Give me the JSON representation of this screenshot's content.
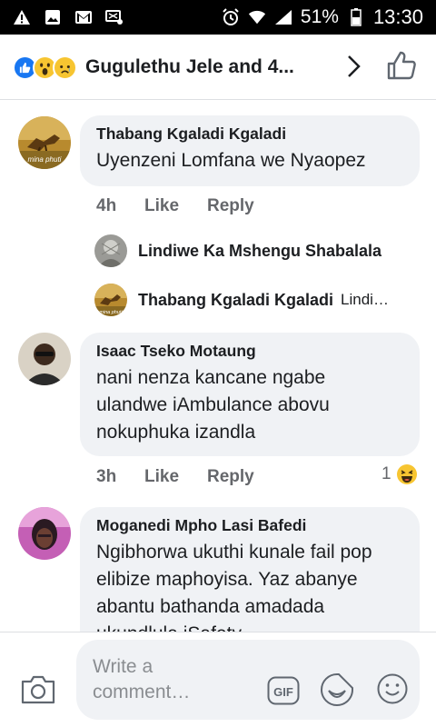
{
  "status_bar": {
    "battery_percent": "51%",
    "time": "13:30"
  },
  "header": {
    "title": "Gugulethu Jele and 4..."
  },
  "comments": [
    {
      "author": "Thabang Kgaladi Kgaladi",
      "text": "Uyenzeni Lomfana we Nyaopez",
      "avatar_caption": "mina phuti",
      "time": "4h",
      "like": "Like",
      "reply": "Reply",
      "replies": [
        {
          "author": "Lindiwe Ka Mshengu Shabalala",
          "preview": ""
        },
        {
          "author": "Thabang Kgaladi Kgaladi",
          "preview": "Lindi…",
          "avatar_caption": "mina phuti"
        }
      ]
    },
    {
      "author": "Isaac Tseko Motaung",
      "text": "nani nenza kancane ngabe ulandwe  iAmbulance abovu nokuphuka izandla",
      "time": "3h",
      "like": "Like",
      "reply": "Reply",
      "reaction_count": "1"
    },
    {
      "author": "Moganedi Mpho Lasi Bafedi",
      "text": "Ngibhorwa ukuthi kunale fail pop elibize maphoyisa. Yaz abanye abantu bathanda amadada ukundlula iSafety"
    }
  ],
  "composer": {
    "placeholder": "Write a comment…",
    "gif_label": "GIF"
  },
  "colors": {
    "like_blue": "#1877f2",
    "bubble_grey": "#f0f2f5",
    "meta_grey": "#65676b"
  }
}
